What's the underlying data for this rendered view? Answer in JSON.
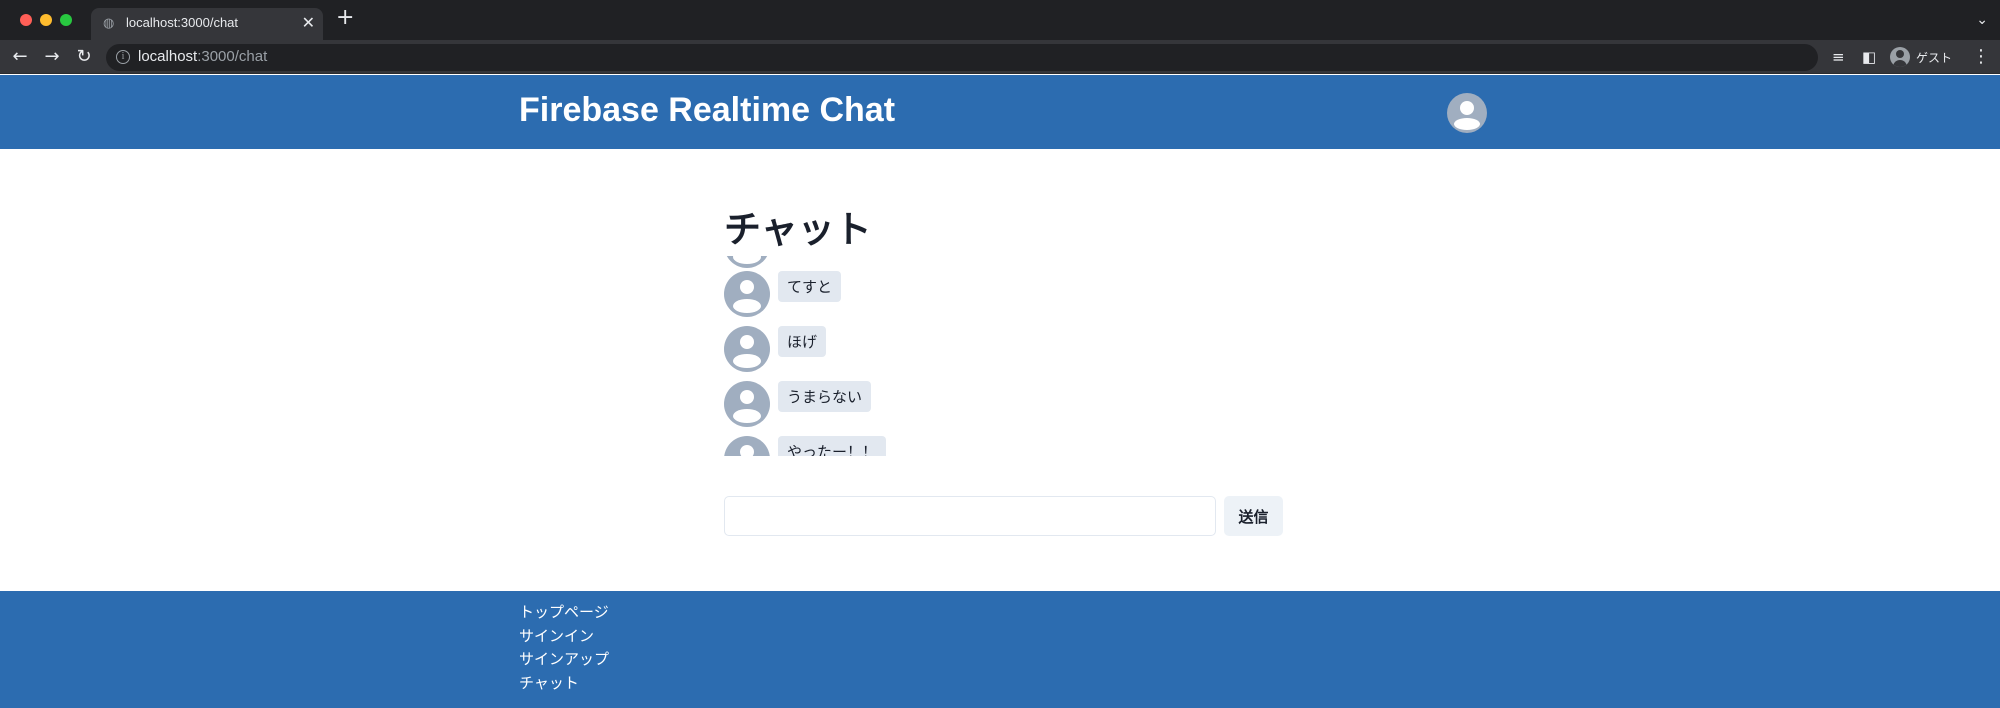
{
  "browser": {
    "tab_title": "localhost:3000/chat",
    "url_host": "localhost",
    "url_path": ":3000/chat",
    "profile_name": "ゲスト"
  },
  "header": {
    "brand": "Firebase Realtime Chat"
  },
  "chat": {
    "heading": "チャット",
    "messages": [
      {
        "text": "てすと"
      },
      {
        "text": "ほげ"
      },
      {
        "text": "うまらない"
      },
      {
        "text": "やったー！！"
      }
    ],
    "input_value": "",
    "send_label": "送信"
  },
  "footer": {
    "links": [
      "トップページ",
      "サインイン",
      "サインアップ",
      "チャット"
    ]
  },
  "colors": {
    "brand_blue": "#2c6cb0",
    "avatar_gray": "#a0aec0",
    "bubble_bg": "#e2e8f0"
  }
}
